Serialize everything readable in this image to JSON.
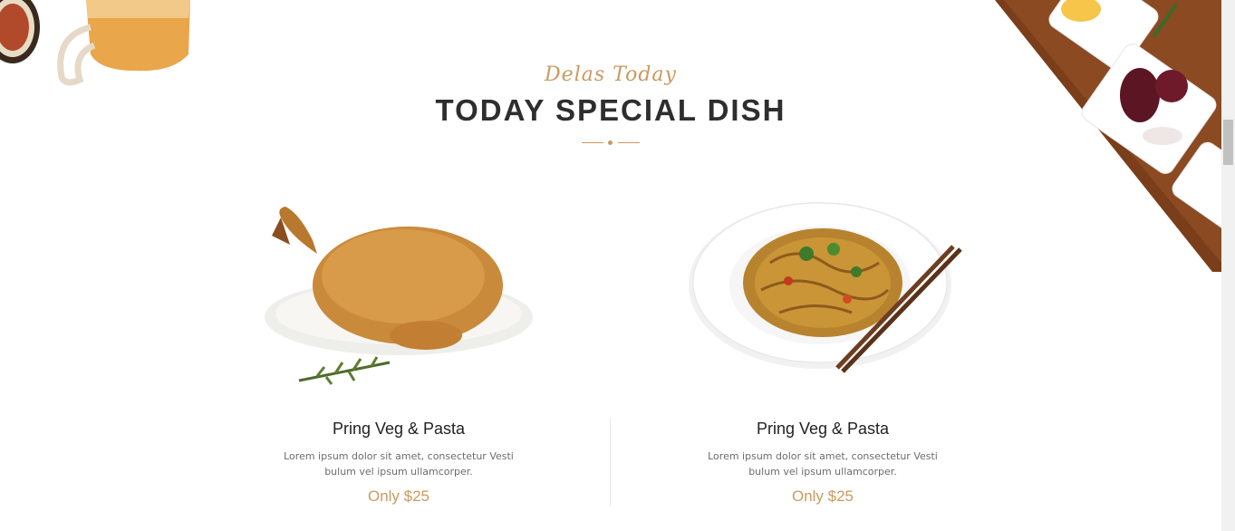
{
  "section": {
    "subtitle": "Delas Today",
    "title": "TODAY SPECIAL DISH"
  },
  "dishes": [
    {
      "name": "Pring Veg & Pasta",
      "description_line1": "Lorem ipsum dolor sit amet, consectetur Vesti",
      "description_line2": "bulum vel ipsum ullamcorper.",
      "price": "Only $25",
      "image": "roast-chicken"
    },
    {
      "name": "Pring Veg & Pasta",
      "description_line1": "Lorem ipsum dolor sit amet, consectetur Vesti",
      "description_line2": "bulum vel ipsum ullamcorper.",
      "price": "Only $25",
      "image": "noodle-plate-with-chopsticks"
    }
  ],
  "colors": {
    "accent": "#c99a60",
    "title": "#2e2e2e",
    "text": "#6c6c6c"
  }
}
